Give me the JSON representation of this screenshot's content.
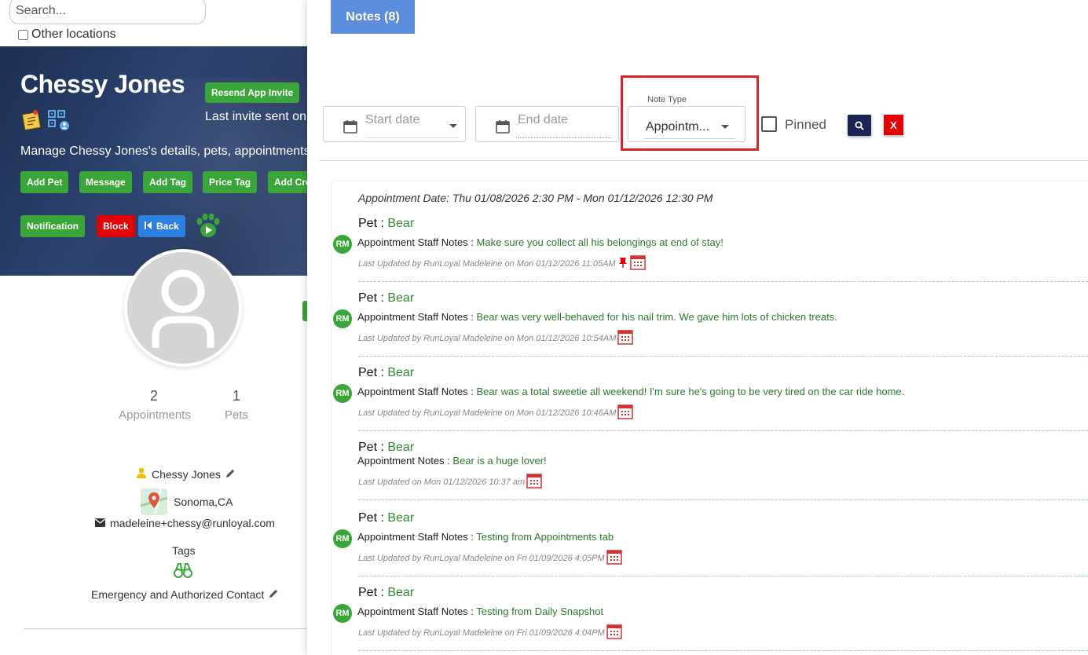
{
  "search": {
    "placeholder": "Search..."
  },
  "other_locations": {
    "label": "Other locations",
    "checked": false
  },
  "customer": {
    "name": "Chessy Jones",
    "resend_label": "Resend App Invite",
    "last_invite": "Last invite sent on",
    "manage_text": "Manage Chessy Jones's details, pets, appointments"
  },
  "actions": {
    "add_pet": "Add Pet",
    "message": "Message",
    "add_tag": "Add Tag",
    "price_tag": "Price Tag",
    "add_credit": "Add Cre",
    "notification": "Notification",
    "block": "Block",
    "back": "Back"
  },
  "stats": {
    "appointments": {
      "value": "2",
      "label": "Appointments"
    },
    "pets": {
      "value": "1",
      "label": "Pets"
    }
  },
  "contact": {
    "name": "Chessy Jones",
    "location": "Sonoma,CA",
    "email": "madeleine+chessy@runloyal.com",
    "tags_label": "Tags",
    "emergency_label": "Emergency and Authorized Contact"
  },
  "notes_tab": {
    "label": "Notes (8)"
  },
  "filters": {
    "start_date_placeholder": "Start date",
    "end_date_placeholder": "End date",
    "note_type_label": "Note Type",
    "note_type_value": "Appointm...",
    "pinned_label": "Pinned",
    "clear_label": "X"
  },
  "appointment_date": "Appointment Date: Thu 01/08/2026 2:30 PM - Mon 01/12/2026 12:30 PM",
  "notes": [
    {
      "pet_label": "Pet : ",
      "pet_name": "Bear",
      "initials": "RM",
      "type": "Appointment Staff Notes : ",
      "text": "Make sure you collect all his belongings at end of stay!",
      "updated": "Last Updated by RunLoyal Madeleine on Mon 01/12/2026 11:05AM",
      "pinned": true
    },
    {
      "pet_label": "Pet : ",
      "pet_name": "Bear",
      "initials": "RM",
      "type": "Appointment Staff Notes : ",
      "text": "Bear was very well-behaved for his nail trim. We gave him lots of chicken treats.",
      "updated": "Last Updated by RunLoyal Madeleine on Mon 01/12/2026 10:54AM",
      "pinned": false
    },
    {
      "pet_label": "Pet : ",
      "pet_name": "Bear",
      "initials": "RM",
      "type": "Appointment Staff Notes : ",
      "text": "Bear was a total sweetie all weekend! I'm sure he's going to be very tired on the car ride home.",
      "updated": "Last Updated by RunLoyal Madeleine on Mon 01/12/2026 10:46AM",
      "pinned": false
    },
    {
      "pet_label": "Pet : ",
      "pet_name": "Bear",
      "initials": "",
      "type": "Appointment Notes : ",
      "text": "Bear is a huge lover!",
      "updated": "Last Updated on Mon 01/12/2026 10:37 am",
      "pinned": false
    },
    {
      "pet_label": "Pet : ",
      "pet_name": "Bear",
      "initials": "RM",
      "type": "Appointment Staff Notes : ",
      "text": "Testing from Appointments tab",
      "updated": "Last Updated by RunLoyal Madeleine on Fri 01/09/2026 4:05PM",
      "pinned": false
    },
    {
      "pet_label": "Pet : ",
      "pet_name": "Bear",
      "initials": "RM",
      "type": "Appointment Staff Notes : ",
      "text": "Testing from Daily Snapshot",
      "updated": "Last Updated by RunLoyal Madeleine on Fri 01/09/2026 4:04PM",
      "pinned": false
    }
  ],
  "colors": {
    "green": "#3aa63a",
    "red": "#e30000",
    "blue_tab": "#5b8ddc",
    "navy": "#1c2454",
    "note_text_green": "#2a7d2a",
    "highlight_frame": "#d8232a"
  }
}
